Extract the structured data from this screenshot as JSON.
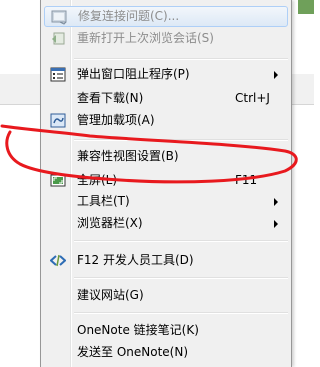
{
  "menu": {
    "items": [
      {
        "label": "修复连接问题(C)...",
        "shortcut": "",
        "disabled": true,
        "submenu": false,
        "icon": "repair-icon"
      },
      {
        "label": "重新打开上次浏览会话(S)",
        "shortcut": "",
        "disabled": true,
        "submenu": false,
        "icon": "reopen-session-icon"
      },
      {
        "label": "弹出窗口阻止程序(P)",
        "shortcut": "",
        "disabled": false,
        "submenu": true,
        "icon": "popup-blocker-icon"
      },
      {
        "label": "查看下载(N)",
        "shortcut": "Ctrl+J",
        "disabled": false,
        "submenu": false,
        "icon": ""
      },
      {
        "label": "管理加载项(A)",
        "shortcut": "",
        "disabled": false,
        "submenu": false,
        "icon": "manage-addons-icon"
      },
      {
        "label": "兼容性视图设置(B)",
        "shortcut": "",
        "disabled": false,
        "submenu": false,
        "icon": ""
      },
      {
        "label": "全屏(L)",
        "shortcut": "F11",
        "disabled": false,
        "submenu": false,
        "icon": "fullscreen-icon"
      },
      {
        "label": "工具栏(T)",
        "shortcut": "",
        "disabled": false,
        "submenu": true,
        "icon": ""
      },
      {
        "label": "浏览器栏(X)",
        "shortcut": "",
        "disabled": false,
        "submenu": true,
        "icon": ""
      },
      {
        "label": "F12 开发人员工具(D)",
        "shortcut": "",
        "disabled": false,
        "submenu": false,
        "icon": "developer-tools-icon"
      },
      {
        "label": "建议网站(G)",
        "shortcut": "",
        "disabled": false,
        "submenu": false,
        "icon": ""
      },
      {
        "label": "OneNote 链接笔记(K)",
        "shortcut": "",
        "disabled": false,
        "submenu": false,
        "icon": ""
      },
      {
        "label": "发送至 OneNote(N)",
        "shortcut": "",
        "disabled": false,
        "submenu": false,
        "icon": ""
      }
    ]
  },
  "annotation": {
    "color": "#e8191e",
    "shape": "hand-drawn-ellipse"
  }
}
